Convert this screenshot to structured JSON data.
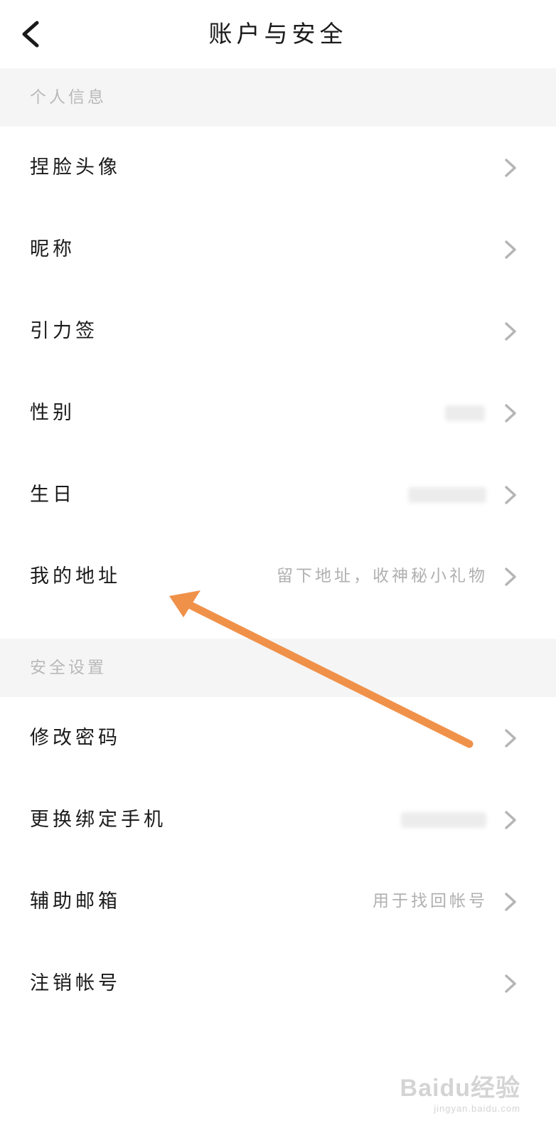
{
  "header": {
    "title": "账户与安全",
    "back_icon": "chevron-left-icon"
  },
  "sections": [
    {
      "title": "个人信息",
      "items": [
        {
          "label": "捏脸头像",
          "value": ""
        },
        {
          "label": "昵称",
          "value": ""
        },
        {
          "label": "引力签",
          "value": ""
        },
        {
          "label": "性别",
          "value": ""
        },
        {
          "label": "生日",
          "value": ""
        },
        {
          "label": "我的地址",
          "value": "留下地址，收神秘小礼物"
        }
      ]
    },
    {
      "title": "安全设置",
      "items": [
        {
          "label": "修改密码",
          "value": ""
        },
        {
          "label": "更换绑定手机",
          "value": ""
        },
        {
          "label": "辅助邮箱",
          "value": "用于找回帐号"
        },
        {
          "label": "注销帐号",
          "value": ""
        }
      ]
    }
  ],
  "annotation": {
    "arrow_color": "#f0914a"
  },
  "watermark": {
    "brand": "Baidu经验",
    "domain": "jingyan.baidu.com"
  },
  "colors": {
    "section_bg": "#f5f5f5",
    "section_text": "#b9b9b9",
    "value_text": "#b0b0b0",
    "chevron": "#b5b5b5"
  }
}
